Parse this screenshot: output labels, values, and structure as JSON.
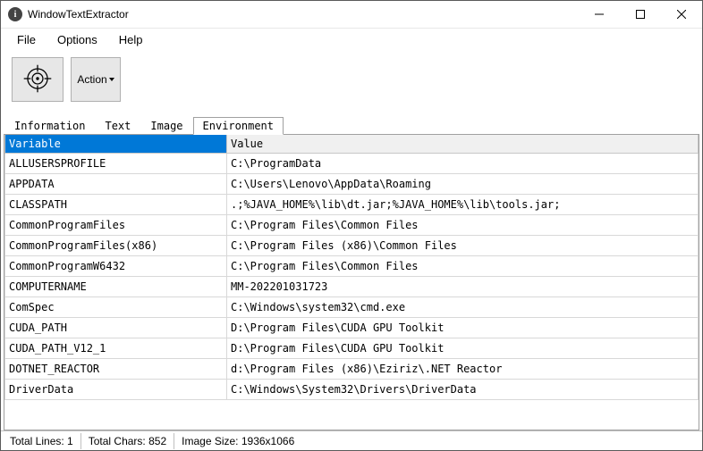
{
  "window": {
    "title": "WindowTextExtractor"
  },
  "menu": {
    "file": "File",
    "options": "Options",
    "help": "Help"
  },
  "toolbar": {
    "action_label": "Action"
  },
  "tabs": {
    "information": "Information",
    "text": "Text",
    "image": "Image",
    "environment": "Environment"
  },
  "grid": {
    "header_variable": "Variable",
    "header_value": "Value",
    "rows": [
      {
        "variable": "ALLUSERSPROFILE",
        "value": "C:\\ProgramData"
      },
      {
        "variable": "APPDATA",
        "value": "C:\\Users\\Lenovo\\AppData\\Roaming"
      },
      {
        "variable": "CLASSPATH",
        "value": ".;%JAVA_HOME%\\lib\\dt.jar;%JAVA_HOME%\\lib\\tools.jar;"
      },
      {
        "variable": "CommonProgramFiles",
        "value": "C:\\Program Files\\Common Files"
      },
      {
        "variable": "CommonProgramFiles(x86)",
        "value": "C:\\Program Files (x86)\\Common Files"
      },
      {
        "variable": "CommonProgramW6432",
        "value": "C:\\Program Files\\Common Files"
      },
      {
        "variable": "COMPUTERNAME",
        "value": "MM-202201031723"
      },
      {
        "variable": "ComSpec",
        "value": "C:\\Windows\\system32\\cmd.exe"
      },
      {
        "variable": "CUDA_PATH",
        "value": "D:\\Program Files\\CUDA GPU Toolkit"
      },
      {
        "variable": "CUDA_PATH_V12_1",
        "value": "D:\\Program Files\\CUDA GPU Toolkit"
      },
      {
        "variable": "DOTNET_REACTOR",
        "value": "d:\\Program Files (x86)\\Eziriz\\.NET Reactor"
      },
      {
        "variable": "DriverData",
        "value": "C:\\Windows\\System32\\Drivers\\DriverData"
      }
    ]
  },
  "status": {
    "total_lines_label": "Total Lines:",
    "total_lines": "1",
    "total_chars_label": "Total Chars:",
    "total_chars": "852",
    "image_size_label": "Image Size:",
    "image_size": "1936x1066"
  }
}
